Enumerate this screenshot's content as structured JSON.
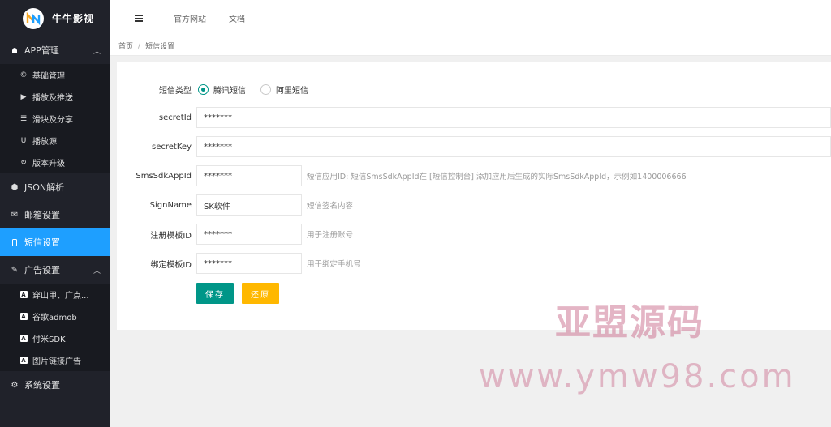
{
  "app": {
    "title": "牛牛影视",
    "logo_icon": "logo-icon"
  },
  "sidebar": {
    "groups": [
      {
        "label": "APP管理",
        "icon": "android-icon",
        "expanded": true,
        "items": [
          {
            "label": "基础管理",
            "icon": "copyright-icon"
          },
          {
            "label": "播放及推送",
            "icon": "play-icon"
          },
          {
            "label": "滑块及分享",
            "icon": "sliders-icon"
          },
          {
            "label": "播放源",
            "icon": "magnet-icon"
          },
          {
            "label": "版本升级",
            "icon": "refresh-icon"
          }
        ]
      },
      {
        "label": "JSON解析",
        "icon": "cube-icon"
      },
      {
        "label": "邮箱设置",
        "icon": "envelope-icon"
      },
      {
        "label": "短信设置",
        "icon": "mobile-icon",
        "active": true
      },
      {
        "label": "广告设置",
        "icon": "magic-wand-icon",
        "expanded": true,
        "items": [
          {
            "label": "穿山甲、广点...",
            "icon": "ad-icon"
          },
          {
            "label": "谷歌admob",
            "icon": "ad-icon"
          },
          {
            "label": "付米SDK",
            "icon": "ad-icon"
          },
          {
            "label": "图片链接广告",
            "icon": "ad-icon"
          }
        ]
      },
      {
        "label": "系统设置",
        "icon": "gears-icon"
      }
    ]
  },
  "header": {
    "links": [
      "官方网站",
      "文档"
    ]
  },
  "breadcrumb": {
    "home": "首页",
    "sep": "/",
    "current": "短信设置"
  },
  "form": {
    "sms_type": {
      "label": "短信类型",
      "options": [
        "腾讯短信",
        "阿里短信"
      ],
      "selected": 0
    },
    "secret_id": {
      "label": "secretId",
      "value": "*******"
    },
    "secret_key": {
      "label": "secretKey",
      "value": "*******"
    },
    "sdk_app_id": {
      "label": "SmsSdkAppId",
      "value": "*******",
      "hint": "短信应用ID: 短信SmsSdkAppId在 [短信控制台] 添加应用后生成的实际SmsSdkAppId，示例如1400006666"
    },
    "sign_name": {
      "label": "SignName",
      "value": "SK软件",
      "hint": "短信签名内容"
    },
    "register_tpl": {
      "label": "注册模板ID",
      "value": "*******",
      "hint": "用于注册账号"
    },
    "bind_tpl": {
      "label": "绑定模板ID",
      "value": "*******",
      "hint": "用于绑定手机号"
    },
    "save_label": "保存",
    "reset_label": "还原"
  },
  "watermark": {
    "line1": "亚盟源码",
    "line2": "www.ymw98.com"
  },
  "colors": {
    "sidebar": "#20222a",
    "active": "#1e9fff",
    "primary": "#009688",
    "warm": "#ffb800"
  }
}
